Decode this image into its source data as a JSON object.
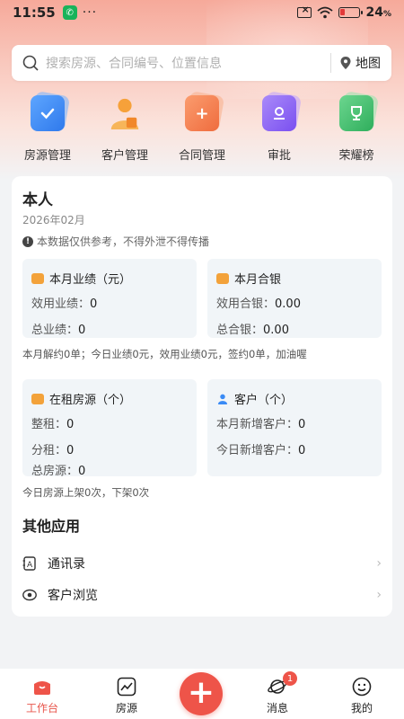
{
  "status_bar": {
    "time": "11:55",
    "dots": "···",
    "battery": "24",
    "battery_unit": "%"
  },
  "search": {
    "placeholder": "搜索房源、合同编号、位置信息",
    "map_label": "地图"
  },
  "quick_apps": [
    {
      "label": "房源管理",
      "icon": "house-check-icon",
      "color": "#3a8bf5"
    },
    {
      "label": "客户管理",
      "icon": "customer-icon",
      "color": "#f39a2e"
    },
    {
      "label": "合同管理",
      "icon": "contract-add-icon",
      "color": "#f07a4a"
    },
    {
      "label": "审批",
      "icon": "approval-icon",
      "color": "#8b5cf0"
    },
    {
      "label": "荣耀榜",
      "icon": "trophy-icon",
      "color": "#3bbf6a"
    }
  ],
  "card": {
    "title": "本人",
    "date": "2026年02月",
    "notice": "本数据仅供参考，不得外泄不得传播",
    "performance": {
      "title": "本月业绩（元）",
      "effective_label": "效用业绩：",
      "effective_value": "0",
      "total_label": "总业绩：",
      "total_value": "0"
    },
    "contract_amount": {
      "title": "本月合银",
      "effective_label": "效用合银：",
      "effective_value": "0.00",
      "total_label": "总合银：",
      "total_value": "0.00"
    },
    "summary1": "本月解约0单；今日业绩0元，效用业绩0元，签约0单，加油喔",
    "rentals": {
      "title": "在租房源（个）",
      "whole_label": "整租：",
      "whole_value": "0",
      "shared_label": "分租：",
      "shared_value": "0",
      "total_label": "总房源：",
      "total_value": "0"
    },
    "customers": {
      "title": "客户（个）",
      "month_label": "本月新增客户：",
      "month_value": "0",
      "today_label": "今日新增客户：",
      "today_value": "0"
    },
    "summary2": "今日房源上架0次，下架0次",
    "other_title": "其他应用",
    "other_items": [
      {
        "label": "通讯录",
        "icon": "contacts-icon"
      },
      {
        "label": "客户浏览",
        "icon": "eye-icon"
      }
    ]
  },
  "bottom_nav": {
    "items": [
      {
        "label": "工作台",
        "icon": "workbench-icon"
      },
      {
        "label": "房源",
        "icon": "chart-icon"
      },
      {
        "label": "消息",
        "icon": "planet-icon",
        "badge": "1"
      },
      {
        "label": "我的",
        "icon": "smile-icon"
      }
    ],
    "fab": "+"
  },
  "colors": {
    "accent": "#ee5449",
    "stat_bg": "#f1f5f8"
  }
}
